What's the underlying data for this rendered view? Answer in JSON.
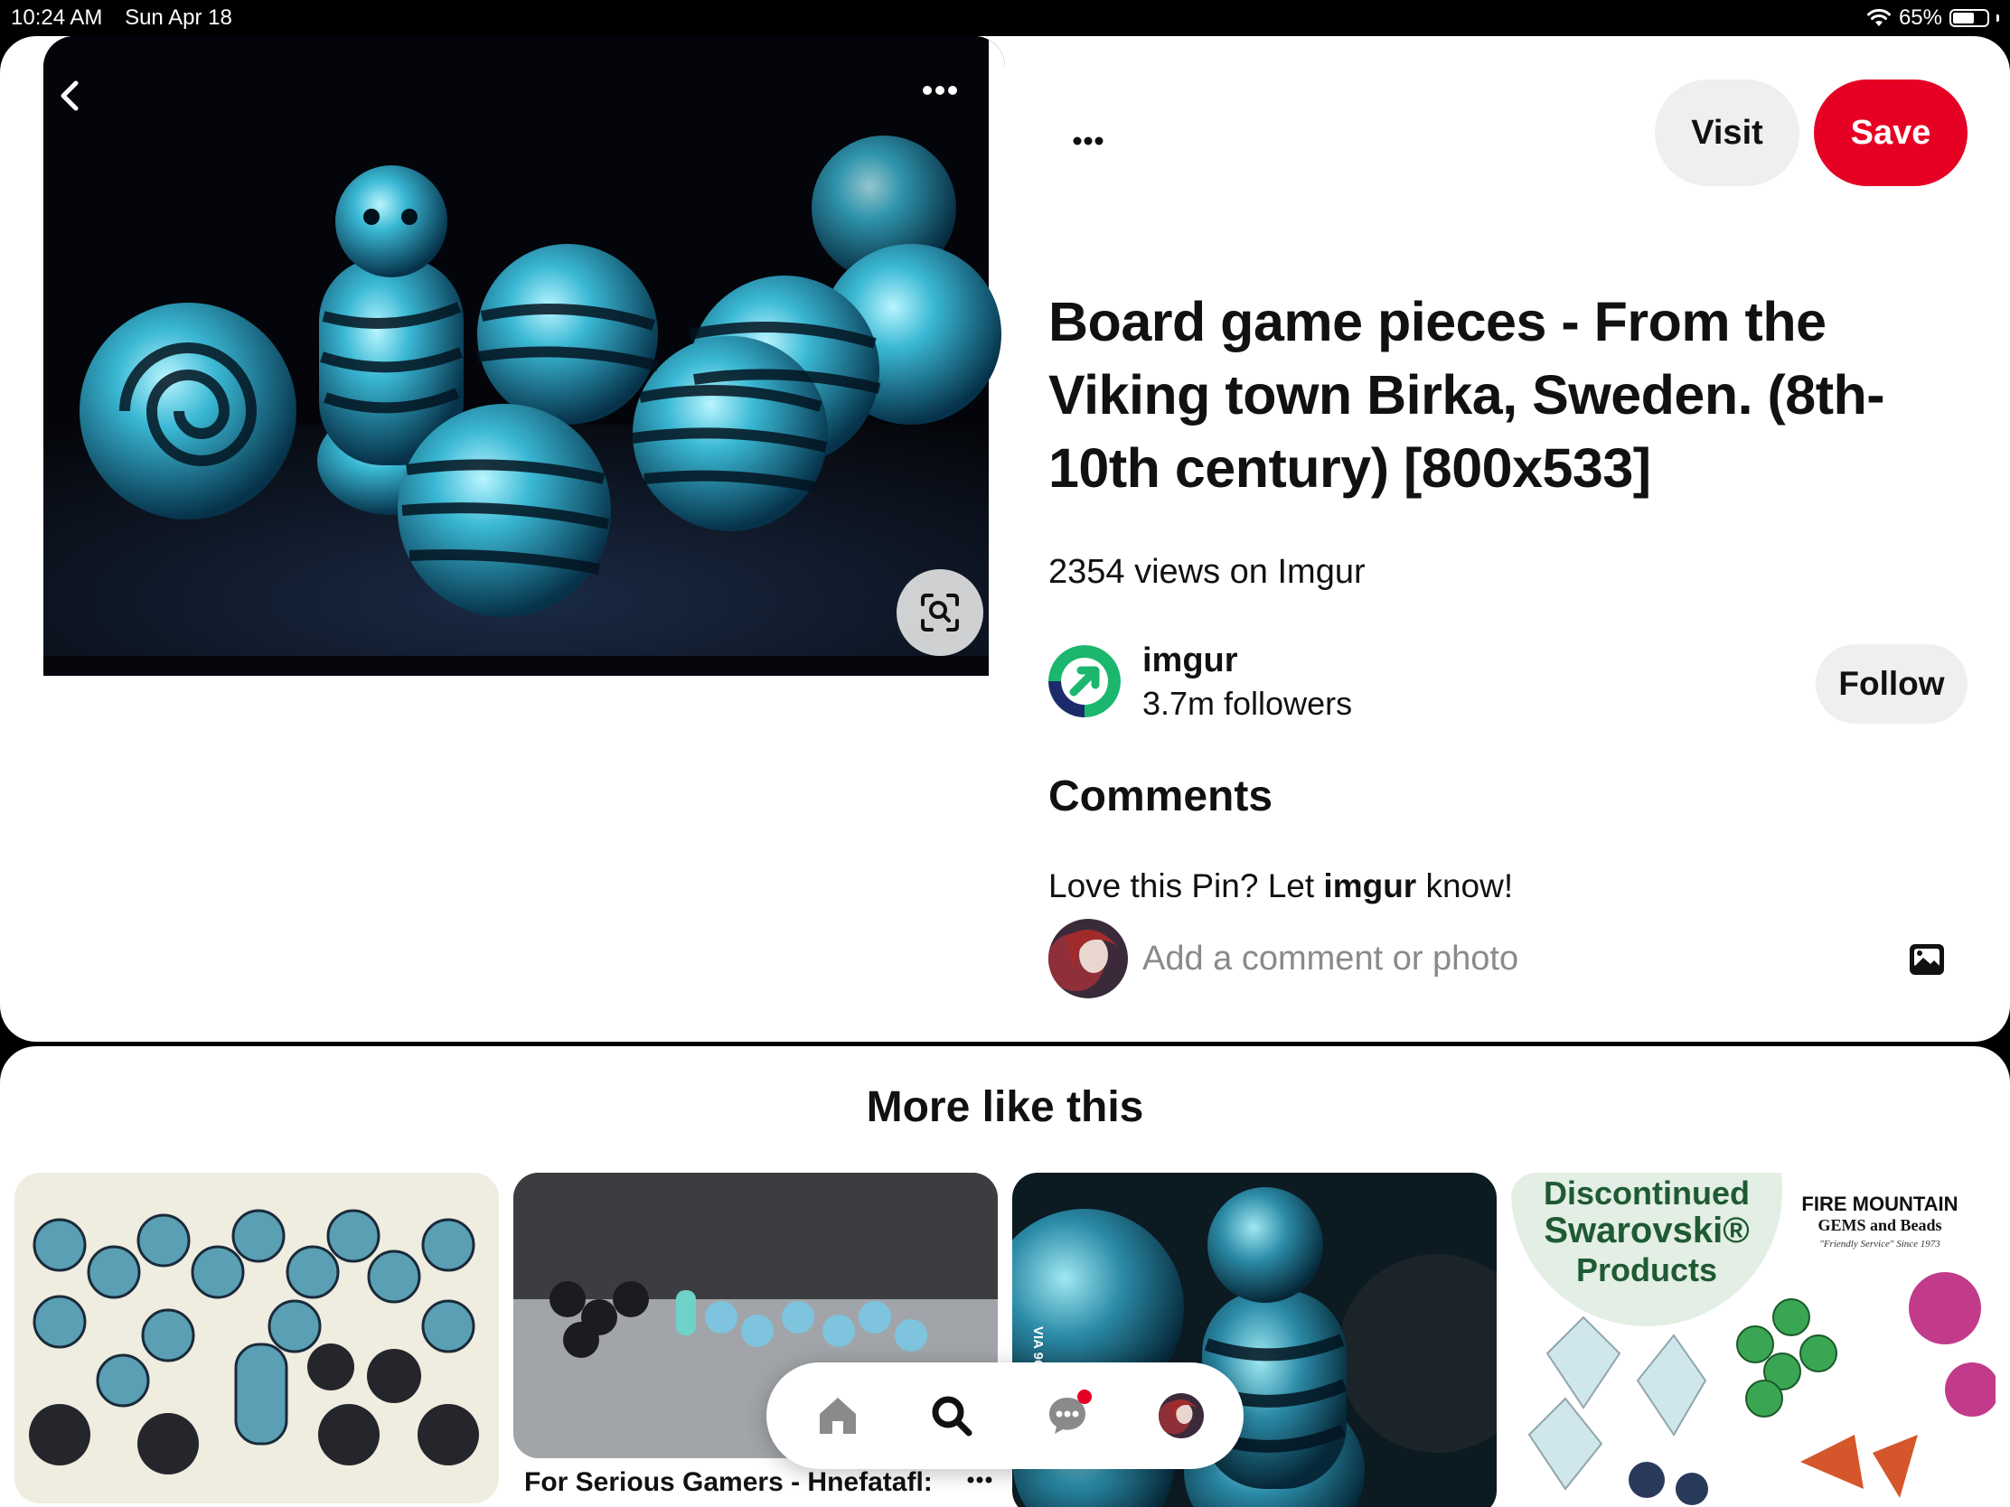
{
  "status_bar": {
    "time": "10:24 AM",
    "date": "Sun Apr 18",
    "battery": "65%",
    "battery_level": 0.65
  },
  "pin": {
    "title": "Board game pieces - From the Viking town Birka, Sweden. (8th-10th century) [800x533]",
    "views": "2354 views on Imgur",
    "visit_label": "Visit",
    "save_label": "Save",
    "save_color": "#e60023"
  },
  "creator": {
    "name": "imgur",
    "followers": "3.7m followers",
    "follow_label": "Follow",
    "avatar_color": "#1bb76e"
  },
  "comments": {
    "heading": "Comments",
    "prompt_before": "Love this Pin? Let ",
    "prompt_name": "imgur",
    "prompt_after": " know!",
    "input_placeholder": "Add a comment or photo"
  },
  "more_like_this": {
    "heading": "More like this",
    "tiles": [
      {
        "caption": "For Serious Gamers - Hnefatafl:"
      }
    ],
    "tile2_watermark": "VIA 9GAG.C",
    "tile4_badge_line1": "Discontinued",
    "tile4_badge_line2": "Swarovski®",
    "tile4_badge_line3": "Products",
    "tile4_brand_line1": "FIRE MOUNTAIN",
    "tile4_brand_line2": "GEMS and Beads",
    "tile4_brand_line3": "\"Friendly Service\" Since 1973"
  },
  "icons": {
    "back": "chevron-left-icon",
    "more": "ellipsis-icon",
    "lens": "visual-search-icon",
    "photo": "image-icon",
    "home": "home-icon",
    "search": "search-icon",
    "messages": "chat-icon",
    "profile": "avatar"
  }
}
